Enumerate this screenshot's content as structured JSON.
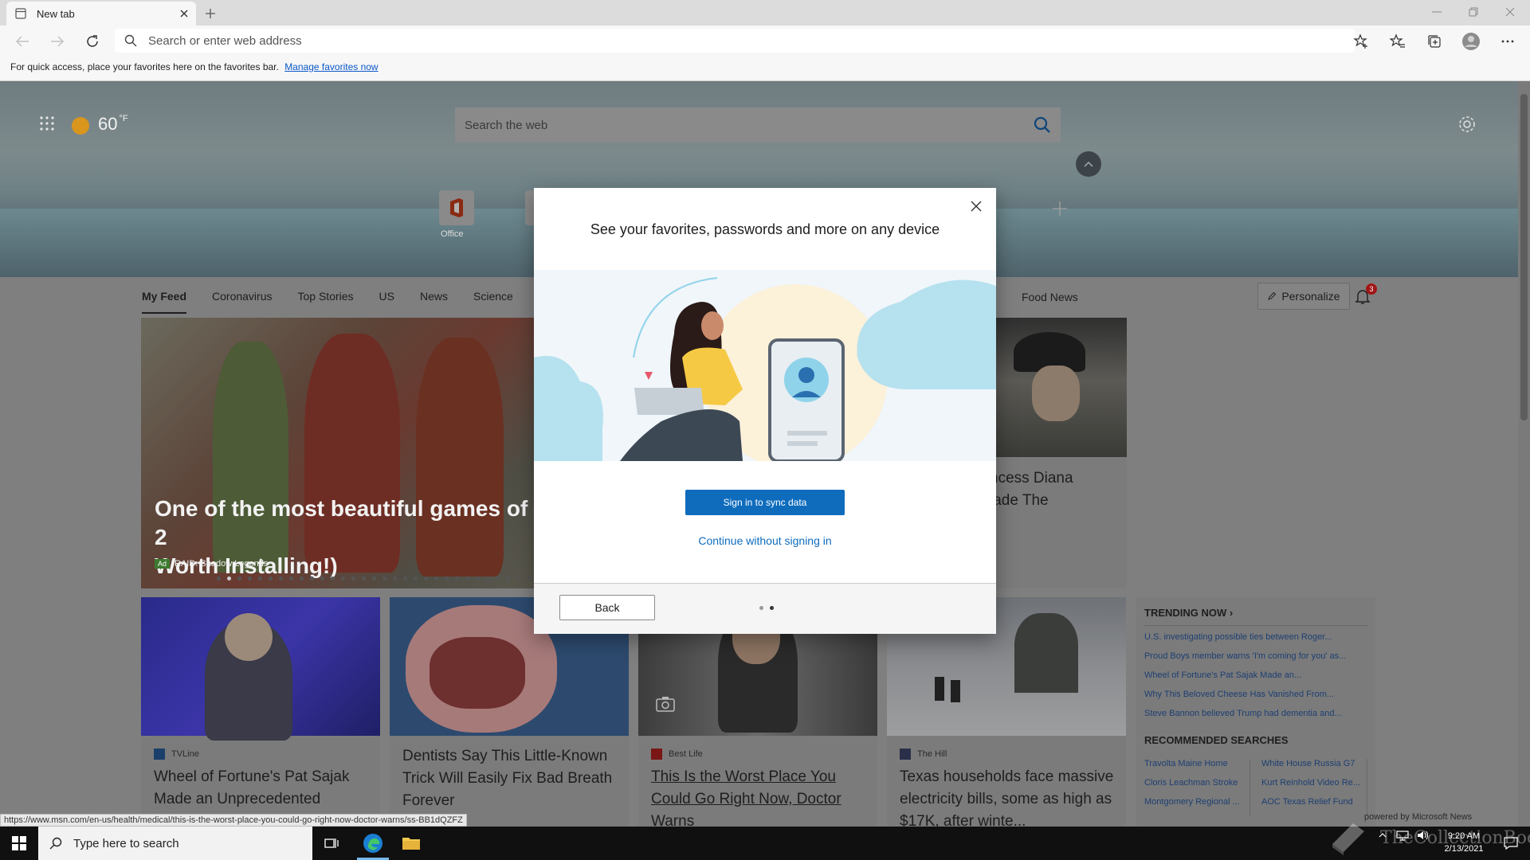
{
  "browser": {
    "tab_title": "New tab",
    "address_placeholder": "Search or enter web address",
    "favorites_bar_text": "For quick access, place your favorites here on the favorites bar.",
    "favorites_bar_link": "Manage favorites now"
  },
  "newtab": {
    "temperature": "60",
    "temperature_unit": "°F",
    "search_placeholder": "Search the web",
    "quick_link_office": "Office",
    "feed_tabs": [
      "My Feed",
      "Coronavirus",
      "Top Stories",
      "US",
      "News",
      "Science"
    ],
    "feed_tab_food": "Food News",
    "personalize_label": "Personalize",
    "notification_count": "3"
  },
  "feed": {
    "big_card": {
      "title": "One of the most beautiful games of 2",
      "title_line2": "Worth Installing!)",
      "ad_badge": "Ad",
      "ad_source": "RAID: Shadow Legends"
    },
    "diana_card": {
      "title_line1": "ncess Diana",
      "title_line2": "lade The"
    },
    "cards": [
      {
        "source": "TVLine",
        "title": "Wheel of Fortune's Pat Sajak Made an Unprecedented"
      },
      {
        "source": "",
        "title": "Dentists Say This Little-Known Trick Will Easily Fix Bad Breath Forever"
      },
      {
        "source": "Best Life",
        "title": "This Is the Worst Place You Could Go Right Now, Doctor Warns"
      },
      {
        "source": "The Hill",
        "title": "Texas households face massive electricity bills, some as high as $17K, after winte..."
      }
    ],
    "trending_title": "TRENDING NOW",
    "trending": [
      "U.S. investigating possible ties between Roger...",
      "Proud Boys member warns 'I'm coming for you' as...",
      "Wheel of Fortune's Pat Sajak Made an...",
      "Why This Beloved Cheese Has Vanished From...",
      "Steve Bannon believed Trump had dementia and..."
    ],
    "recommended_title": "RECOMMENDED SEARCHES",
    "recommended": [
      "Travolta Maine Home",
      "White House Russia G7",
      "Cloris Leachman Stroke",
      "Kurt Reinhold Video Re...",
      "Montgomery Regional ...",
      "AOC Texas Relief Fund"
    ],
    "powered_by": "powered by Microsoft News"
  },
  "status_url": "https://www.msn.com/en-us/health/medical/this-is-the-worst-place-you-could-go-right-now-doctor-warns/ss-BB1dQZFZ",
  "modal": {
    "title": "See your favorites, passwords and more on any device",
    "signin_label": "Sign in to sync data",
    "continue_label": "Continue without signing in",
    "back_label": "Back"
  },
  "taskbar": {
    "search_placeholder": "Type here to search",
    "time": "9:20 AM",
    "date": "2/13/2021"
  },
  "watermark": "TheCollectionBook",
  "colors": {
    "accent": "#0f6cbd",
    "link": "#0b57c9",
    "taskbar": "#101010"
  }
}
